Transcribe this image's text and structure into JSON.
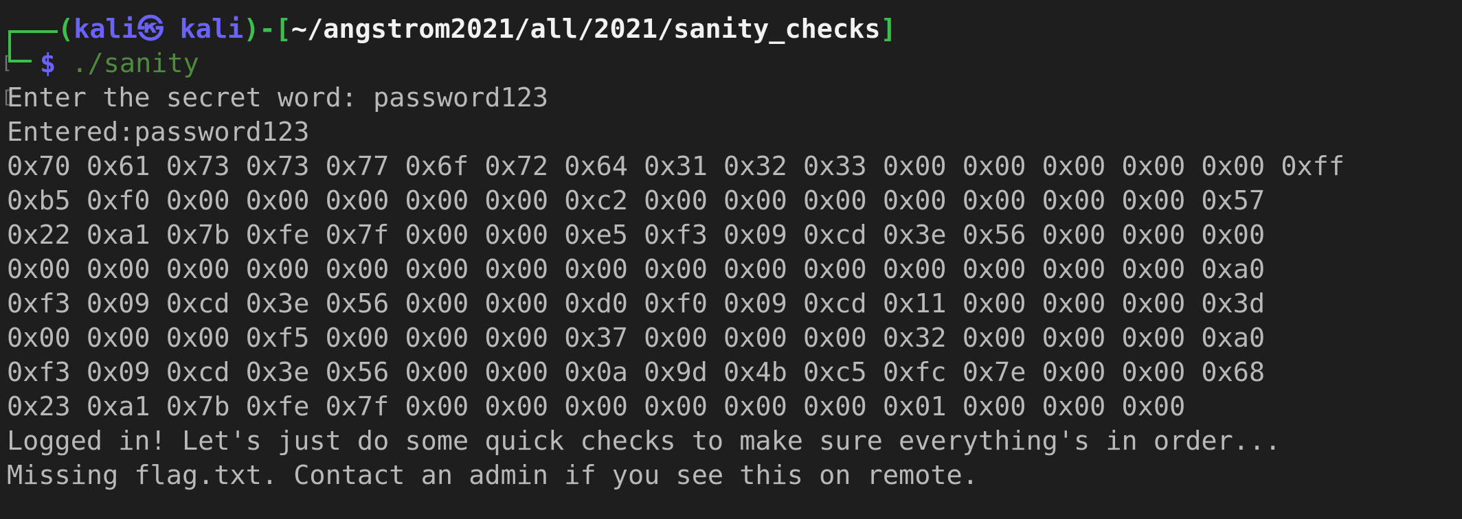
{
  "prompt": {
    "open_paren": "(",
    "user": "kali",
    "symbol": "㉿",
    "host": "kali",
    "close_paren": ")",
    "dash": "-",
    "open_bracket": "[",
    "path": "~/angstrom2021/all/2021/sanity_checks",
    "close_bracket": "]",
    "dollar": "$",
    "command": " ./sanity"
  },
  "output": {
    "secret_prompt": "Enter the secret word: password123",
    "entered": "Entered:password123",
    "hex_rows": [
      "0x70 0x61 0x73 0x73 0x77 0x6f 0x72 0x64 0x31 0x32 0x33 0x00 0x00 0x00 0x00 0x00 0xff",
      "0xb5 0xf0 0x00 0x00 0x00 0x00 0x00 0xc2 0x00 0x00 0x00 0x00 0x00 0x00 0x00 0x57",
      "0x22 0xa1 0x7b 0xfe 0x7f 0x00 0x00 0xe5 0xf3 0x09 0xcd 0x3e 0x56 0x00 0x00 0x00",
      "0x00 0x00 0x00 0x00 0x00 0x00 0x00 0x00 0x00 0x00 0x00 0x00 0x00 0x00 0x00 0xa0",
      "0xf3 0x09 0xcd 0x3e 0x56 0x00 0x00 0xd0 0xf0 0x09 0xcd 0x11 0x00 0x00 0x00 0x3d",
      "0x00 0x00 0x00 0xf5 0x00 0x00 0x00 0x37 0x00 0x00 0x00 0x32 0x00 0x00 0x00 0xa0",
      "0xf3 0x09 0xcd 0x3e 0x56 0x00 0x00 0x0a 0x9d 0x4b 0xc5 0xfc 0x7e 0x00 0x00 0x68",
      "0x23 0xa1 0x7b 0xfe 0x7f 0x00 0x00 0x00 0x00 0x00 0x00 0x01 0x00 0x00 0x00"
    ],
    "logged_in": "Logged in! Let's just do some quick checks to make sure everything's in order...",
    "missing_flag": "Missing flag.txt. Contact an admin if you see this on remote."
  },
  "colors": {
    "background": "#1e1e1e",
    "prompt_green": "#3dbf4e",
    "prompt_blue": "#6b63ff",
    "command_green": "#4f8a3f",
    "output_gray": "#b9b9b9"
  }
}
